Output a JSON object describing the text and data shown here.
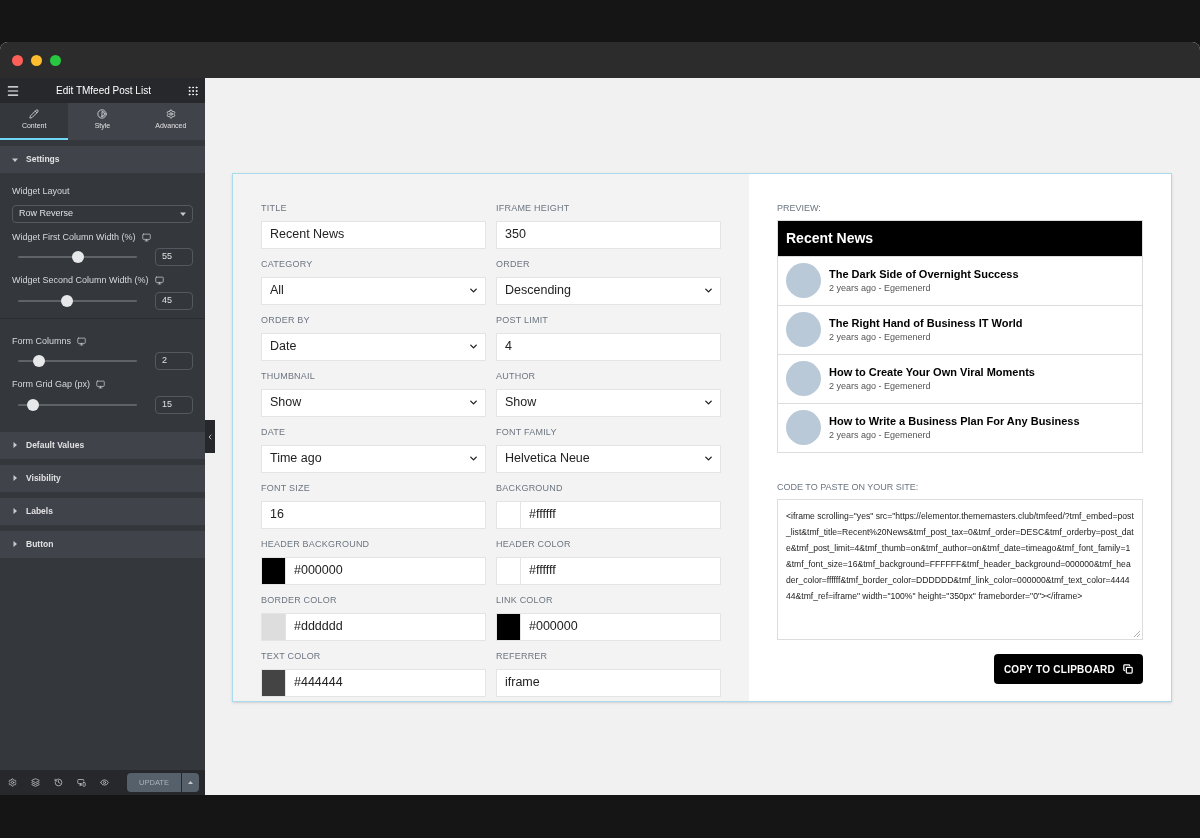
{
  "sidebar": {
    "title": "Edit TMfeed Post List",
    "tabs": [
      {
        "label": "Content",
        "selected": true
      },
      {
        "label": "Style",
        "selected": false
      },
      {
        "label": "Advanced",
        "selected": false
      }
    ],
    "sections": [
      {
        "title": "Settings",
        "expanded": true,
        "controls": [
          {
            "kind": "select",
            "label": "Widget Layout",
            "value": "Row Reverse"
          },
          {
            "kind": "slider",
            "label": "Widget First Column Width (%)",
            "level": 0.5,
            "value": "55"
          },
          {
            "kind": "slider",
            "label": "Widget Second Column Width (%)",
            "level": 0.41,
            "value": "45"
          },
          {
            "kind": "divider"
          },
          {
            "kind": "slider",
            "label": "Form Columns",
            "level": 0.18,
            "value": "2"
          },
          {
            "kind": "slider",
            "label": "Form Grid Gap (px)",
            "level": 0.13,
            "value": "15"
          }
        ]
      },
      {
        "title": "Default Values",
        "expanded": false
      },
      {
        "title": "Visibility",
        "expanded": false
      },
      {
        "title": "Labels",
        "expanded": false
      },
      {
        "title": "Button",
        "expanded": false
      }
    ],
    "update_button": "UPDATE"
  },
  "form": {
    "fields": [
      {
        "kind": "text",
        "label": "TITLE",
        "value": "Recent News"
      },
      {
        "kind": "text",
        "label": "IFRAME HEIGHT",
        "value": "350"
      },
      {
        "kind": "select",
        "label": "CATEGORY",
        "value": "All"
      },
      {
        "kind": "select",
        "label": "ORDER",
        "value": "Descending"
      },
      {
        "kind": "select",
        "label": "ORDER BY",
        "value": "Date"
      },
      {
        "kind": "text",
        "label": "POST LIMIT",
        "value": "4"
      },
      {
        "kind": "select",
        "label": "THUMBNAIL",
        "value": "Show"
      },
      {
        "kind": "select",
        "label": "AUTHOR",
        "value": "Show"
      },
      {
        "kind": "select",
        "label": "DATE",
        "value": "Time ago"
      },
      {
        "kind": "select",
        "label": "FONT FAMILY",
        "value": "Helvetica Neue"
      },
      {
        "kind": "text",
        "label": "FONT SIZE",
        "value": "16"
      },
      {
        "kind": "color",
        "label": "BACKGROUND",
        "value": "#ffffff",
        "color": "#ffffff"
      },
      {
        "kind": "color",
        "label": "HEADER BACKGROUND",
        "value": "#000000",
        "color": "#000000"
      },
      {
        "kind": "color",
        "label": "HEADER COLOR",
        "value": "#ffffff",
        "color": "#ffffff"
      },
      {
        "kind": "color",
        "label": "BORDER COLOR",
        "value": "#dddddd",
        "color": "#dddddd"
      },
      {
        "kind": "color",
        "label": "LINK COLOR",
        "value": "#000000",
        "color": "#000000"
      },
      {
        "kind": "color",
        "label": "TEXT COLOR",
        "value": "#444444",
        "color": "#444444"
      },
      {
        "kind": "text",
        "label": "REFERRER",
        "value": "iframe"
      }
    ]
  },
  "preview": {
    "label": "PREVIEW:",
    "header": "Recent News",
    "posts": [
      {
        "title": "The Dark Side of Overnight Success",
        "meta": "2 years ago - Egemenerd"
      },
      {
        "title": "The Right Hand of Business IT World",
        "meta": "2 years ago - Egemenerd"
      },
      {
        "title": "How to Create Your Own Viral Moments",
        "meta": "2 years ago - Egemenerd"
      },
      {
        "title": "How to Write a Business Plan For Any Business",
        "meta": "2 years ago - Egemenerd"
      }
    ],
    "code_label": "CODE TO PASTE ON YOUR SITE:",
    "code": "<iframe scrolling=\"yes\" src=\"https://elementor.thememasters.club/tmfeed/?tmf_embed=post_list&tmf_title=Recent%20News&tmf_post_tax=0&tmf_order=DESC&tmf_orderby=post_date&tmf_post_limit=4&tmf_thumb=on&tmf_author=on&tmf_date=timeago&tmf_font_family=1&tmf_font_size=16&tmf_background=FFFFFF&tmf_header_background=000000&tmf_header_color=ffffff&tmf_border_color=DDDDDD&tmf_link_color=000000&tmf_text_color=444444&tmf_ref=iframe\" width=\"100%\" height=\"350px\" frameborder=\"0\"></iframe>",
    "copy_button": "COPY TO CLIPBOARD"
  }
}
